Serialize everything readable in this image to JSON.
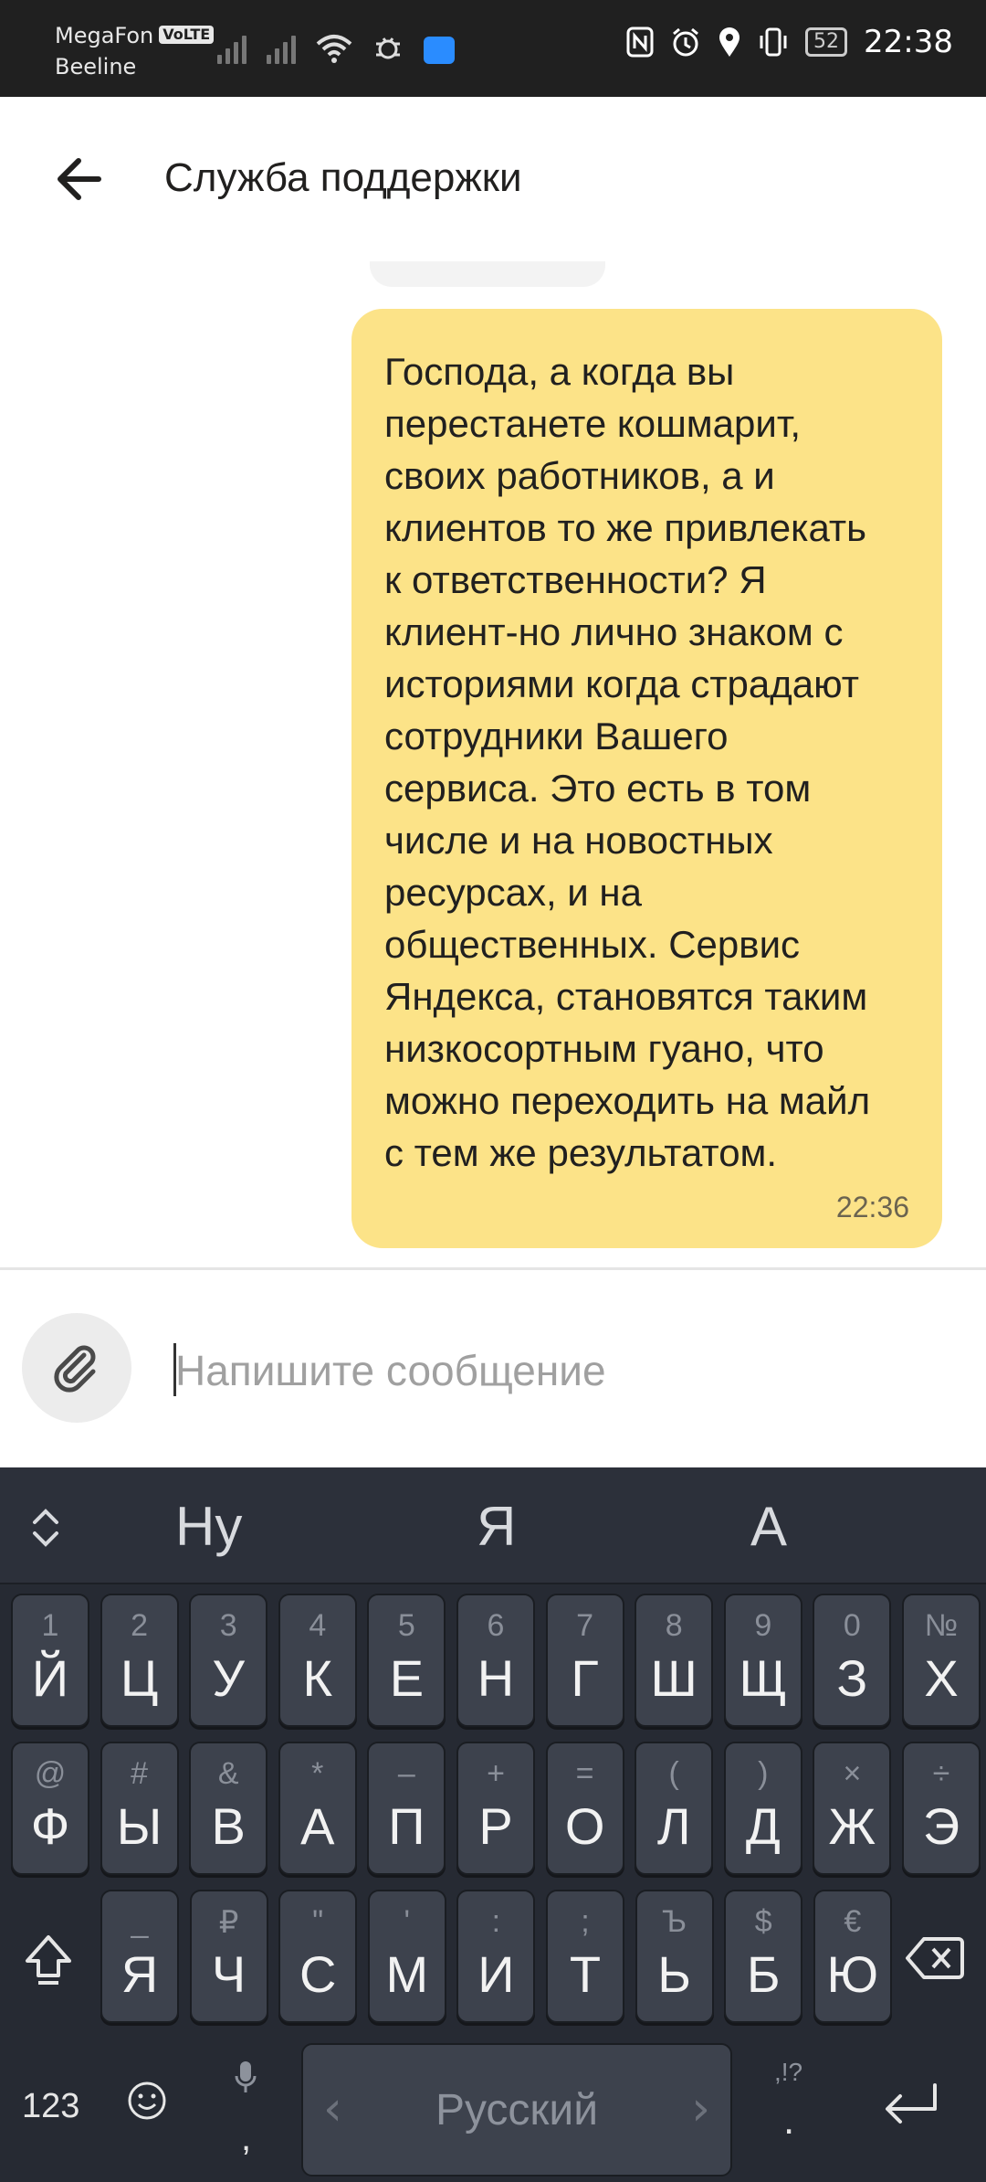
{
  "status_bar": {
    "carrier1": "MegaFon",
    "volte": "VoLTE",
    "carrier2": "Beeline",
    "battery": "52",
    "time": "22:38"
  },
  "header": {
    "title": "Служба поддержки"
  },
  "message": {
    "text": "Господа, а когда вы\nперестанете кошмарит,\nсвоих работников, а и\nклиентов то же привлекать\nк ответственности? Я\nклиент-но лично знаком с\nисториями когда страдают\nсотрудники Вашего\nсервиса. Это есть в том\nчисле и на новостных\nресурсах, и на\nобщественных. Сервис\nЯндекса, становятся таким\nнизкосортным гуано, что\nможно переходить на майл\nс тем же результатом.",
    "time": "22:36"
  },
  "composer": {
    "placeholder": "Напишите сообщение"
  },
  "keyboard": {
    "suggestions": [
      "Ну",
      "Я",
      "А"
    ],
    "row1": [
      {
        "sub": "1",
        "main": "Й"
      },
      {
        "sub": "2",
        "main": "Ц"
      },
      {
        "sub": "3",
        "main": "У"
      },
      {
        "sub": "4",
        "main": "К"
      },
      {
        "sub": "5",
        "main": "Е"
      },
      {
        "sub": "6",
        "main": "Н"
      },
      {
        "sub": "7",
        "main": "Г"
      },
      {
        "sub": "8",
        "main": "Ш"
      },
      {
        "sub": "9",
        "main": "Щ"
      },
      {
        "sub": "0",
        "main": "З"
      },
      {
        "sub": "№",
        "main": "Х"
      }
    ],
    "row2": [
      {
        "sub": "@",
        "main": "Ф"
      },
      {
        "sub": "#",
        "main": "Ы"
      },
      {
        "sub": "&",
        "main": "В"
      },
      {
        "sub": "*",
        "main": "А"
      },
      {
        "sub": "–",
        "main": "П"
      },
      {
        "sub": "+",
        "main": "Р"
      },
      {
        "sub": "=",
        "main": "О"
      },
      {
        "sub": "(",
        "main": "Л"
      },
      {
        "sub": ")",
        "main": "Д"
      },
      {
        "sub": "×",
        "main": "Ж"
      },
      {
        "sub": "÷",
        "main": "Э"
      }
    ],
    "row3": [
      {
        "sub": "_",
        "main": "Я"
      },
      {
        "sub": "₽",
        "main": "Ч"
      },
      {
        "sub": "\"",
        "main": "С"
      },
      {
        "sub": "'",
        "main": "М"
      },
      {
        "sub": ":",
        "main": "И"
      },
      {
        "sub": ";",
        "main": "Т"
      },
      {
        "sub": "Ъ",
        "main": "Ь"
      },
      {
        "sub": "$",
        "main": "Б"
      },
      {
        "sub": "€",
        "main": "Ю"
      }
    ],
    "numbers_label": "123",
    "comma": ",",
    "space_label": "Русский",
    "period": ".",
    "punct_hint": ",!?"
  },
  "icons": {
    "back": "arrow-left-icon",
    "attach": "paperclip-icon",
    "shift": "shift-icon",
    "backspace": "backspace-icon",
    "emoji": "emoji-icon",
    "mic": "microphone-icon",
    "enter": "enter-icon"
  },
  "colors": {
    "bubble": "#fce388",
    "keyboard_bg": "#262a33",
    "key_bg": "#3d424d",
    "status_bg": "#202020"
  }
}
